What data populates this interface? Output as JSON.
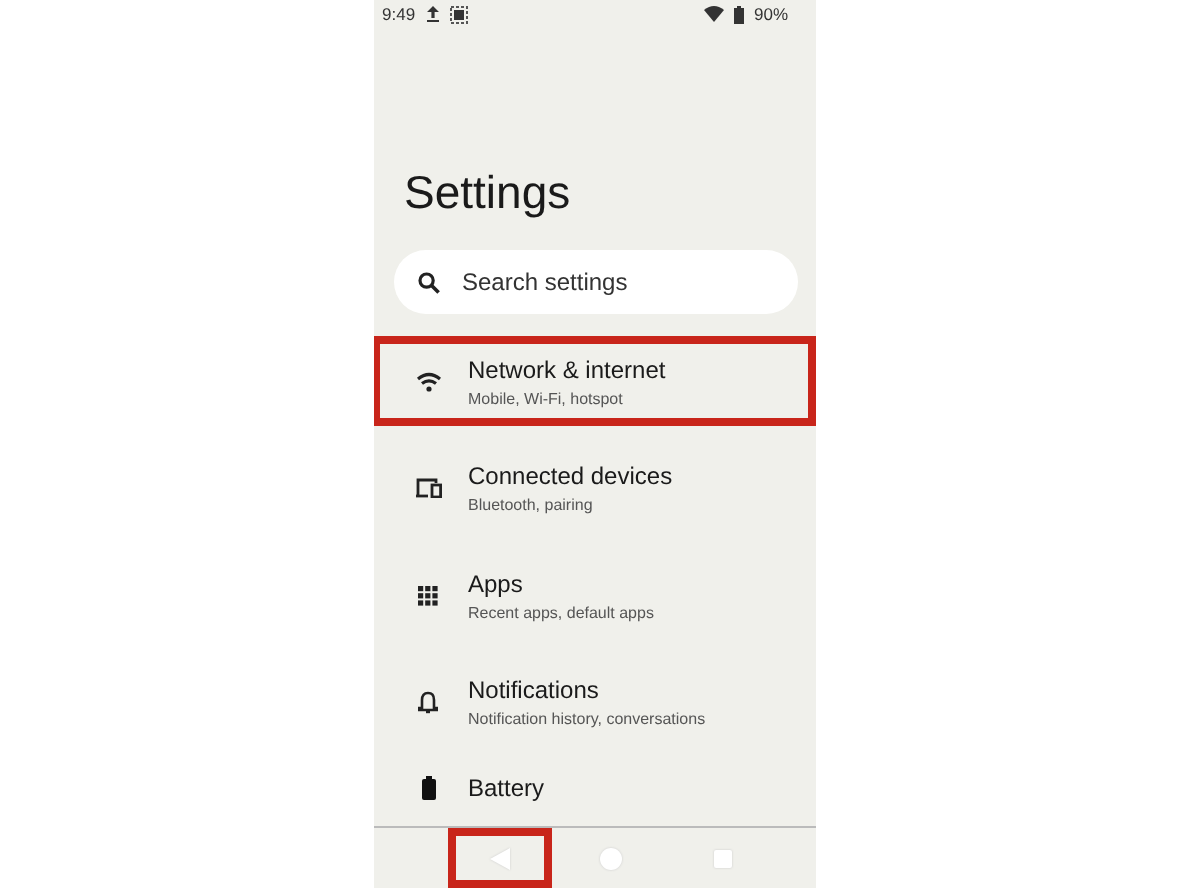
{
  "status_bar": {
    "time": "9:49",
    "battery": "90%"
  },
  "title": "Settings",
  "search": {
    "placeholder": "Search settings"
  },
  "items": [
    {
      "kind": "wifi",
      "title": "Network & internet",
      "subtitle": "Mobile, Wi-Fi, hotspot",
      "highlighted": true
    },
    {
      "kind": "devices",
      "title": "Connected devices",
      "subtitle": "Bluetooth, pairing",
      "highlighted": false
    },
    {
      "kind": "apps",
      "title": "Apps",
      "subtitle": "Recent apps, default apps",
      "highlighted": false
    },
    {
      "kind": "bell",
      "title": "Notifications",
      "subtitle": "Notification history, conversations",
      "highlighted": false
    },
    {
      "kind": "battery",
      "title": "Battery",
      "highlighted": false
    }
  ],
  "nav": [
    {
      "kind": "back",
      "highlighted": true
    },
    {
      "kind": "home",
      "highlighted": false
    },
    {
      "kind": "recents",
      "highlighted": false
    }
  ]
}
